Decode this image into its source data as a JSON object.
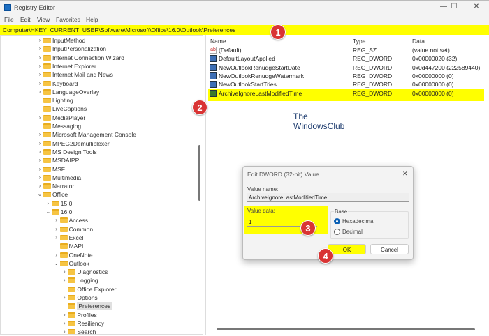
{
  "window": {
    "title": "Registry Editor",
    "minimize": "—",
    "maximize": "☐",
    "close": "✕"
  },
  "menu": [
    "File",
    "Edit",
    "View",
    "Favorites",
    "Help"
  ],
  "address": "Computer\\HKEY_CURRENT_USER\\Software\\Microsoft\\Office\\16.0\\Outlook\\Preferences",
  "tree": [
    {
      "label": "InputMethod",
      "level": 0,
      "state": "collapsed"
    },
    {
      "label": "InputPersonalization",
      "level": 0,
      "state": "collapsed"
    },
    {
      "label": "Internet Connection Wizard",
      "level": 0,
      "state": "collapsed"
    },
    {
      "label": "Internet Explorer",
      "level": 0,
      "state": "collapsed"
    },
    {
      "label": "Internet Mail and News",
      "level": 0,
      "state": "collapsed"
    },
    {
      "label": "Keyboard",
      "level": 0,
      "state": "collapsed"
    },
    {
      "label": "LanguageOverlay",
      "level": 0,
      "state": "collapsed"
    },
    {
      "label": "Lighting",
      "level": 0,
      "state": "leaf"
    },
    {
      "label": "LiveCaptions",
      "level": 0,
      "state": "leaf"
    },
    {
      "label": "MediaPlayer",
      "level": 0,
      "state": "collapsed"
    },
    {
      "label": "Messaging",
      "level": 0,
      "state": "leaf"
    },
    {
      "label": "Microsoft Management Console",
      "level": 0,
      "state": "collapsed"
    },
    {
      "label": "MPEG2Demultiplexer",
      "level": 0,
      "state": "collapsed"
    },
    {
      "label": "MS Design Tools",
      "level": 0,
      "state": "collapsed"
    },
    {
      "label": "MSDAIPP",
      "level": 0,
      "state": "collapsed"
    },
    {
      "label": "MSF",
      "level": 0,
      "state": "collapsed"
    },
    {
      "label": "Multimedia",
      "level": 0,
      "state": "collapsed"
    },
    {
      "label": "Narrator",
      "level": 0,
      "state": "collapsed"
    },
    {
      "label": "Office",
      "level": 0,
      "state": "expanded"
    },
    {
      "label": "15.0",
      "level": 1,
      "state": "collapsed"
    },
    {
      "label": "16.0",
      "level": 1,
      "state": "expanded"
    },
    {
      "label": "Access",
      "level": 2,
      "state": "collapsed"
    },
    {
      "label": "Common",
      "level": 2,
      "state": "collapsed"
    },
    {
      "label": "Excel",
      "level": 2,
      "state": "collapsed"
    },
    {
      "label": "MAPI",
      "level": 2,
      "state": "leaf"
    },
    {
      "label": "OneNote",
      "level": 2,
      "state": "collapsed"
    },
    {
      "label": "Outlook",
      "level": 2,
      "state": "expanded"
    },
    {
      "label": "Diagnostics",
      "level": 3,
      "state": "collapsed"
    },
    {
      "label": "Logging",
      "level": 3,
      "state": "collapsed"
    },
    {
      "label": "Office Explorer",
      "level": 3,
      "state": "leaf"
    },
    {
      "label": "Options",
      "level": 3,
      "state": "collapsed"
    },
    {
      "label": "Preferences",
      "level": 3,
      "state": "leaf",
      "selected": true
    },
    {
      "label": "Profiles",
      "level": 3,
      "state": "collapsed"
    },
    {
      "label": "Resiliency",
      "level": 3,
      "state": "collapsed"
    },
    {
      "label": "Search",
      "level": 3,
      "state": "collapsed"
    }
  ],
  "list": {
    "headers": {
      "name": "Name",
      "type": "Type",
      "data": "Data"
    },
    "rows": [
      {
        "name": "(Default)",
        "type": "REG_SZ",
        "data": "(value not set)",
        "icon": "string"
      },
      {
        "name": "DefaultLayoutApplied",
        "type": "REG_DWORD",
        "data": "0x00000020 (32)",
        "icon": "binary"
      },
      {
        "name": "NewOutlookRenudgeStartDate",
        "type": "REG_DWORD",
        "data": "0x0d447200 (222589440)",
        "icon": "binary"
      },
      {
        "name": "NewOutlookRenudgeWatermark",
        "type": "REG_DWORD",
        "data": "0x00000000 (0)",
        "icon": "binary"
      },
      {
        "name": "NewOutlookStartTries",
        "type": "REG_DWORD",
        "data": "0x00000000 (0)",
        "icon": "binary"
      },
      {
        "name": "ArchiveIgnoreLastModifiedTime",
        "type": "REG_DWORD",
        "data": "0x00000000 (0)",
        "icon": "binary",
        "highlighted": true
      }
    ]
  },
  "watermark": {
    "line1": "The",
    "line2": "WindowsClub"
  },
  "dialog": {
    "title": "Edit DWORD (32-bit) Value",
    "close": "✕",
    "value_name_label": "Value name:",
    "value_name": "ArchiveIgnoreLastModifiedTime",
    "value_data_label": "Value data:",
    "value_data": "1",
    "base_label": "Base",
    "hex_label": "Hexadecimal",
    "dec_label": "Decimal",
    "ok": "OK",
    "cancel": "Cancel"
  },
  "badges": [
    "1",
    "2",
    "3",
    "4"
  ],
  "colors": {
    "highlight": "#ffff00",
    "badge": "#d93434"
  }
}
